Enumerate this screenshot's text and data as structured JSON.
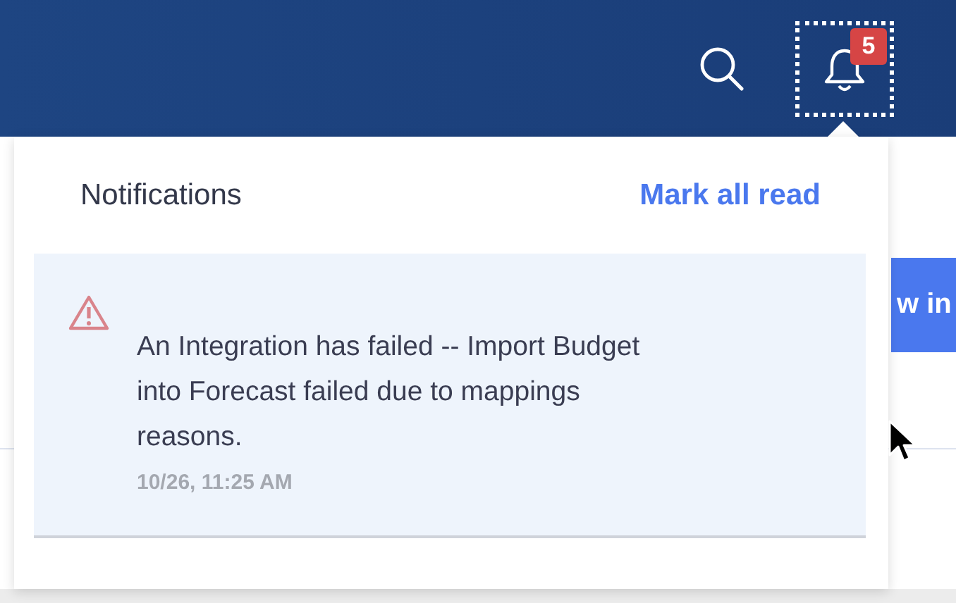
{
  "header": {
    "notification_count": "5"
  },
  "background": {
    "button_label": "w in"
  },
  "notifications_panel": {
    "title": "Notifications",
    "mark_all_read": "Mark all read",
    "items": [
      {
        "kind": "warning",
        "unread": true,
        "message": "An Integration has failed -- Import Budget into Forecast failed due to mappings reasons.",
        "time": "10/26, 11:25 AM"
      }
    ]
  }
}
